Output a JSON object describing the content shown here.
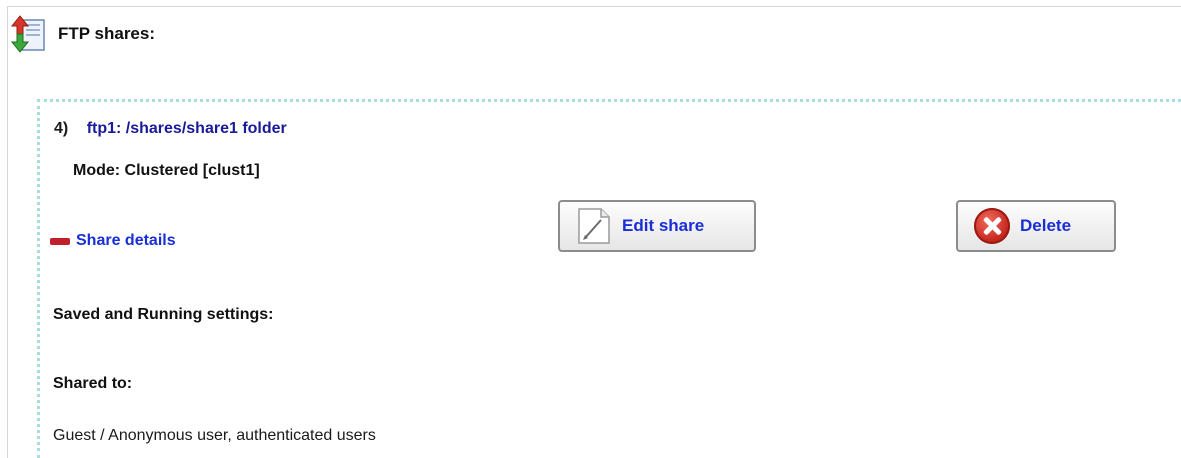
{
  "section": {
    "title": "FTP shares:",
    "icon": "ftp-transfer-icon"
  },
  "share": {
    "index": "4)",
    "name": "ftp1: /shares/share1 folder",
    "mode": "Mode: Clustered [clust1]",
    "details_toggle": {
      "label": "Share details",
      "icon": "collapse-minus-icon",
      "color": "#1a2ed8"
    },
    "buttons": {
      "edit_label": "Edit share",
      "edit_icon": "edit-pencil-icon",
      "delete_label": "Delete",
      "delete_icon": "delete-x-icon"
    },
    "settings_heading": "Saved and Running settings:",
    "shared_to_heading": "Shared to:",
    "shared_to_value": "Guest / Anonymous user, authenticated users"
  },
  "colors": {
    "link": "#1a2ed8",
    "share_name": "#1a1a9a",
    "card_border": "#a8dede",
    "delete_red": "#c1221a"
  }
}
